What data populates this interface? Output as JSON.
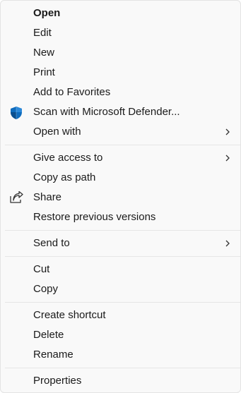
{
  "menu": {
    "groups": [
      {
        "items": [
          {
            "label": "Open",
            "default": true
          },
          {
            "label": "Edit"
          },
          {
            "label": "New"
          },
          {
            "label": "Print"
          },
          {
            "label": "Add to Favorites"
          },
          {
            "label": "Scan with Microsoft Defender...",
            "icon": "defender-shield-icon"
          },
          {
            "label": "Open with",
            "submenu": true
          }
        ]
      },
      {
        "items": [
          {
            "label": "Give access to",
            "submenu": true
          },
          {
            "label": "Copy as path"
          },
          {
            "label": "Share",
            "icon": "share-icon"
          },
          {
            "label": "Restore previous versions"
          }
        ]
      },
      {
        "items": [
          {
            "label": "Send to",
            "submenu": true
          }
        ]
      },
      {
        "items": [
          {
            "label": "Cut"
          },
          {
            "label": "Copy"
          }
        ]
      },
      {
        "items": [
          {
            "label": "Create shortcut"
          },
          {
            "label": "Delete"
          },
          {
            "label": "Rename"
          }
        ]
      },
      {
        "items": [
          {
            "label": "Properties"
          }
        ]
      }
    ],
    "colors": {
      "background": "#f9f9f9",
      "text": "#1a1a1a",
      "separator": "#e6e6e6",
      "defender_blue": "#0f6cbd"
    }
  }
}
